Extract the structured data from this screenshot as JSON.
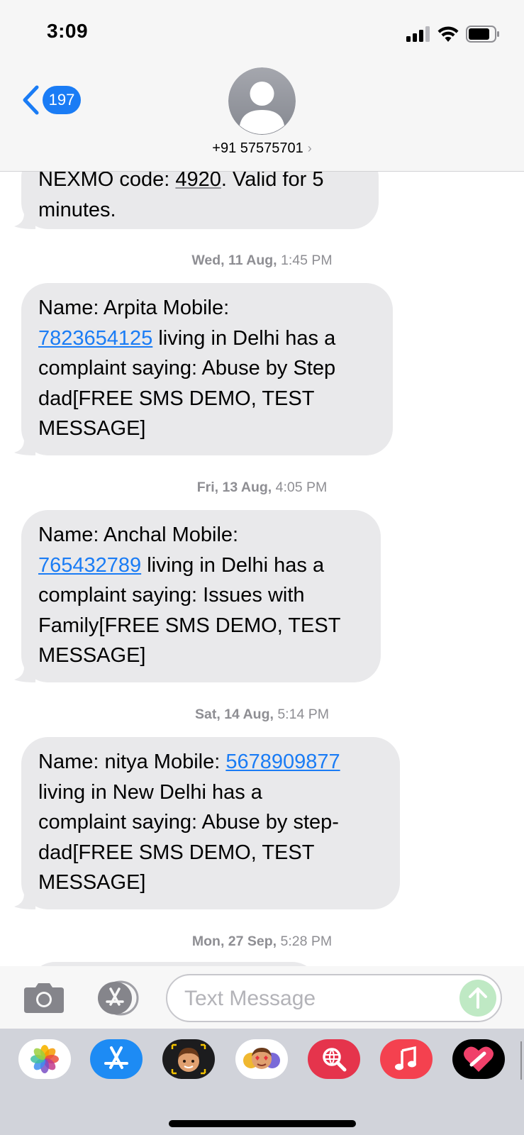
{
  "status_bar": {
    "time": "3:09"
  },
  "header": {
    "unread_count": "197",
    "contact": "+91 57575701",
    "chevron": "›"
  },
  "messages": [
    {
      "type": "partial",
      "line1_a": "NEXMO code: ",
      "code": "4920",
      "line1_b": ". Valid for 5",
      "line2": "minutes."
    },
    {
      "timestamp_day": "Wed, 11 Aug,",
      "timestamp_time": " 1:45 PM",
      "l1": "Name: Arpita Mobile:",
      "phone": "7823654125",
      "l2_rest": " living in Delhi has a",
      "l3": "complaint saying: Abuse by Step",
      "l4": "dad[FREE SMS DEMO, TEST",
      "l5": "MESSAGE]"
    },
    {
      "timestamp_day": "Fri, 13 Aug,",
      "timestamp_time": " 4:05 PM",
      "l1": "Name: Anchal Mobile:",
      "phone": "765432789",
      "l2_rest": " living in Delhi has a",
      "l3": "complaint saying: Issues with",
      "l4": "Family[FREE SMS DEMO, TEST",
      "l5": "MESSAGE]"
    },
    {
      "timestamp_day": "Sat, 14 Aug,",
      "timestamp_time": " 5:14 PM",
      "l1": "Name: nitya Mobile: ",
      "phone": "5678909877",
      "l2": "living in New Delhi has a",
      "l3": "complaint saying: Abuse by step-",
      "l4": "dad[FREE SMS DEMO, TEST",
      "l5": "MESSAGE]"
    },
    {
      "timestamp_day": "Mon, 27 Sep,",
      "timestamp_time": " 5:28 PM"
    }
  ],
  "compose": {
    "placeholder": "Text Message"
  },
  "app_drawer": [
    "photos-icon",
    "app-store-icon",
    "memoji-icon",
    "animoji-stickers-icon",
    "web-search-icon",
    "music-icon",
    "digital-touch-icon"
  ],
  "colors": {
    "accent": "#1a7cf5",
    "bubble": "#e9e9eb",
    "timestamp": "#8e8e93",
    "send_disabled": "#bfe9c4"
  }
}
